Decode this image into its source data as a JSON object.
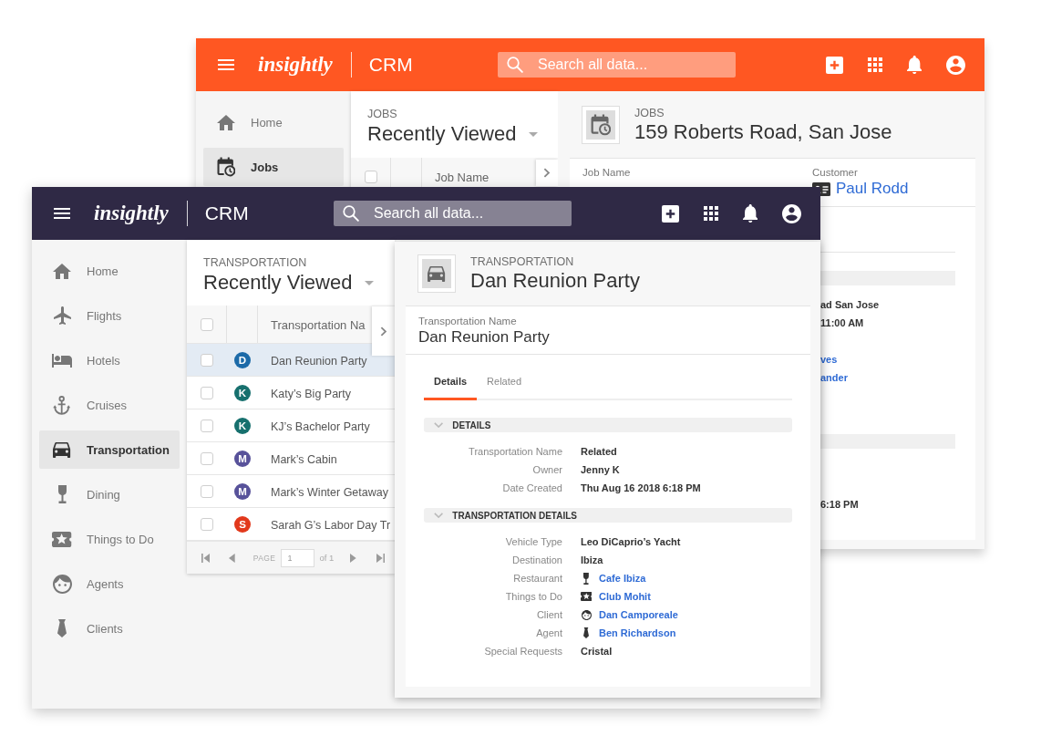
{
  "back_window": {
    "header": {
      "logo": "insightly",
      "app_name": "CRM",
      "search_placeholder": "Search all data..."
    },
    "sidebar": [
      {
        "label": "Home",
        "selected": false
      },
      {
        "label": "Jobs",
        "selected": true
      }
    ],
    "list_panel": {
      "module": "JOBS",
      "view": "Recently Viewed",
      "select_all_checked": false,
      "column_header": "Job Name"
    },
    "record": {
      "module": "JOBS",
      "title": "159 Roberts Road, San Jose",
      "fields": [
        {
          "label": "Job Name"
        },
        {
          "label": "Customer",
          "kind": "link",
          "value": "Paul Rodd"
        }
      ],
      "sections": [
        {
          "values": [
            {
              "kind": "text",
              "text": "ad San Jose"
            },
            {
              "kind": "text",
              "text": "11:00 AM"
            },
            {
              "kind": "link",
              "text": "ves"
            },
            {
              "kind": "link",
              "text": "ander"
            }
          ]
        },
        {
          "values": [
            {
              "kind": "text",
              "text": "6:18 PM"
            }
          ]
        }
      ]
    }
  },
  "front_window": {
    "header": {
      "logo": "insightly",
      "app_name": "CRM",
      "search_placeholder": "Search all data..."
    },
    "sidebar": [
      {
        "label": "Home",
        "selected": false
      },
      {
        "label": "Flights",
        "selected": false
      },
      {
        "label": "Hotels",
        "selected": false
      },
      {
        "label": "Cruises",
        "selected": false
      },
      {
        "label": "Transportation",
        "selected": true
      },
      {
        "label": "Dining",
        "selected": false
      },
      {
        "label": "Things to Do",
        "selected": false
      },
      {
        "label": "Agents",
        "selected": false
      },
      {
        "label": "Clients",
        "selected": false
      }
    ],
    "list_panel": {
      "module": "TRANSPORTATION",
      "view": "Recently Viewed",
      "select_all_checked": false,
      "column_header": "Transportation Na",
      "rows": [
        {
          "initial": "D",
          "color": "#1c6aa8",
          "name": "Dan Reunion Party",
          "selected": true,
          "checked": false
        },
        {
          "initial": "K",
          "color": "#17706e",
          "name": "Katy’s Big Party",
          "selected": false,
          "checked": false
        },
        {
          "initial": "K",
          "color": "#17706e",
          "name": "KJ’s Bachelor Party",
          "selected": false,
          "checked": false
        },
        {
          "initial": "M",
          "color": "#58529a",
          "name": "Mark’s Cabin",
          "selected": false,
          "checked": false
        },
        {
          "initial": "M",
          "color": "#58529a",
          "name": "Mark’s Winter Getaway",
          "selected": false,
          "checked": false
        },
        {
          "initial": "S",
          "color": "#e2391c",
          "name": "Sarah G’s Labor Day Tr",
          "selected": false,
          "checked": false
        }
      ],
      "pagination": {
        "page_label": "PAGE",
        "page": "1",
        "total": "of 1"
      }
    },
    "record": {
      "module": "TRANSPORTATION",
      "title": "Dan Reunion Party",
      "name_field": {
        "label": "Transportation Name",
        "value": "Dan Reunion Party"
      },
      "tabs": [
        {
          "label": "Details",
          "selected": true
        },
        {
          "label": "Related",
          "selected": false
        }
      ],
      "sections": [
        {
          "title": "DETAILS",
          "expanded": true,
          "rows": [
            {
              "label": "Transportation Name",
              "kind": "text",
              "value": "Related"
            },
            {
              "label": "Owner",
              "kind": "text",
              "value": "Jenny K"
            },
            {
              "label": "Date Created",
              "kind": "text",
              "value": "Thu Aug 16 2018 6:18 PM"
            }
          ]
        },
        {
          "title": "TRANSPORTATION DETAILS",
          "expanded": true,
          "rows": [
            {
              "label": "Vehicle Type",
              "kind": "text",
              "value": "Leo DiCaprio’s Yacht"
            },
            {
              "label": "Destination",
              "kind": "text",
              "value": "Ibiza"
            },
            {
              "label": "Restaurant",
              "kind": "link",
              "value": "Cafe Ibiza"
            },
            {
              "label": "Things to Do",
              "kind": "link",
              "value": "Club Mohit"
            },
            {
              "label": "Client",
              "kind": "link",
              "value": "Dan Camporeale"
            },
            {
              "label": "Agent",
              "kind": "link",
              "value": "Ben Richardson"
            },
            {
              "label": "Special Requests",
              "kind": "text",
              "value": "Cristal"
            }
          ]
        }
      ]
    }
  }
}
